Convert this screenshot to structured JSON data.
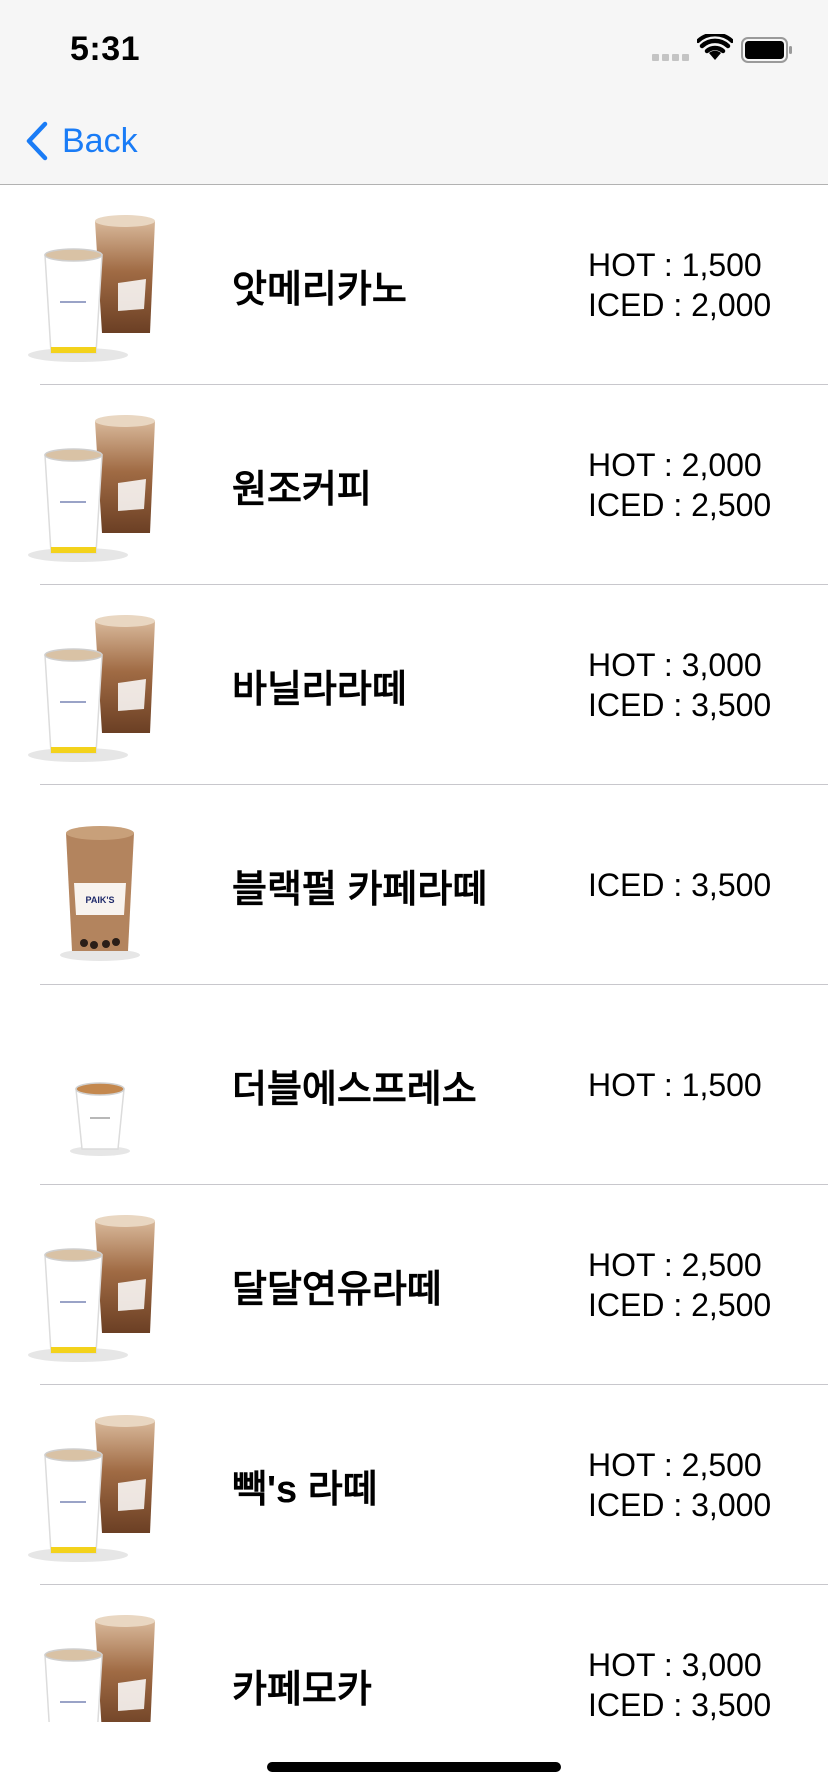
{
  "status_bar": {
    "time": "5:31"
  },
  "nav": {
    "back_label": "Back"
  },
  "menu": [
    {
      "name": "앗메리카노",
      "prices": [
        "HOT : 1,500",
        "ICED : 2,000"
      ],
      "image": "hot-and-iced-cups"
    },
    {
      "name": "원조커피",
      "prices": [
        "HOT : 2,000",
        "ICED : 2,500"
      ],
      "image": "hot-and-iced-cups"
    },
    {
      "name": "바닐라라떼",
      "prices": [
        "HOT : 3,000",
        "ICED : 3,500"
      ],
      "image": "hot-and-iced-cups"
    },
    {
      "name": "블랙펄 카페라떼",
      "prices": [
        "ICED : 3,500"
      ],
      "image": "iced-cup"
    },
    {
      "name": "더블에스프레소",
      "prices": [
        "HOT : 1,500"
      ],
      "image": "small-hot-cup"
    },
    {
      "name": "달달연유라떼",
      "prices": [
        "HOT : 2,500",
        "ICED : 2,500"
      ],
      "image": "hot-and-iced-cups"
    },
    {
      "name": "빽's 라떼",
      "prices": [
        "HOT : 2,500",
        "ICED : 3,000"
      ],
      "image": "hot-and-iced-cups"
    },
    {
      "name": "카페모카",
      "prices": [
        "HOT : 3,000",
        "ICED : 3,500"
      ],
      "image": "hot-and-iced-cups"
    }
  ],
  "colors": {
    "accent": "#1a7cf6",
    "bar_background": "#f6f6f6",
    "separator": "#c8c7cc"
  }
}
